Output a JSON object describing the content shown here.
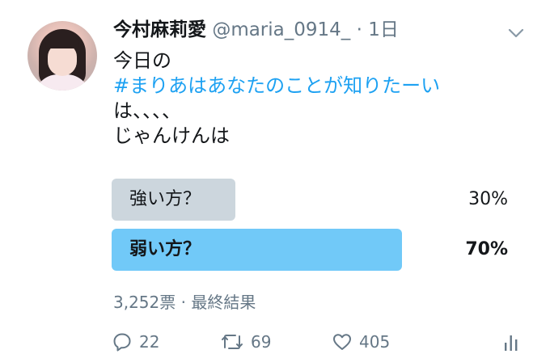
{
  "tweet": {
    "display_name": "今村麻莉愛",
    "handle": "@maria_0914_",
    "separator": "·",
    "time": "1日",
    "text_line1": "今日の",
    "hashtag": "#まりあはあなたのことが知りたーい",
    "text_line3": "は、、、、",
    "text_line4": "じゃんけんは"
  },
  "poll": {
    "options": [
      {
        "label": "強い方？",
        "percent": "30%",
        "percent_value": 30
      },
      {
        "label": "弱い方？",
        "percent": "70%",
        "percent_value": 70
      }
    ],
    "votes": "3,252票",
    "meta_separator": "·",
    "status": "最終結果"
  },
  "actions": {
    "reply_count": "22",
    "retweet_count": "69",
    "like_count": "405"
  },
  "colors": {
    "hashtag": "#1da1f2",
    "poll_winner": "#71c9f8",
    "poll_other": "#ccd6dd",
    "secondary_text": "#657786"
  },
  "icons": {
    "caret": "chevron-down-icon",
    "reply": "reply-icon",
    "retweet": "retweet-icon",
    "like": "heart-icon",
    "analytics": "analytics-icon"
  }
}
